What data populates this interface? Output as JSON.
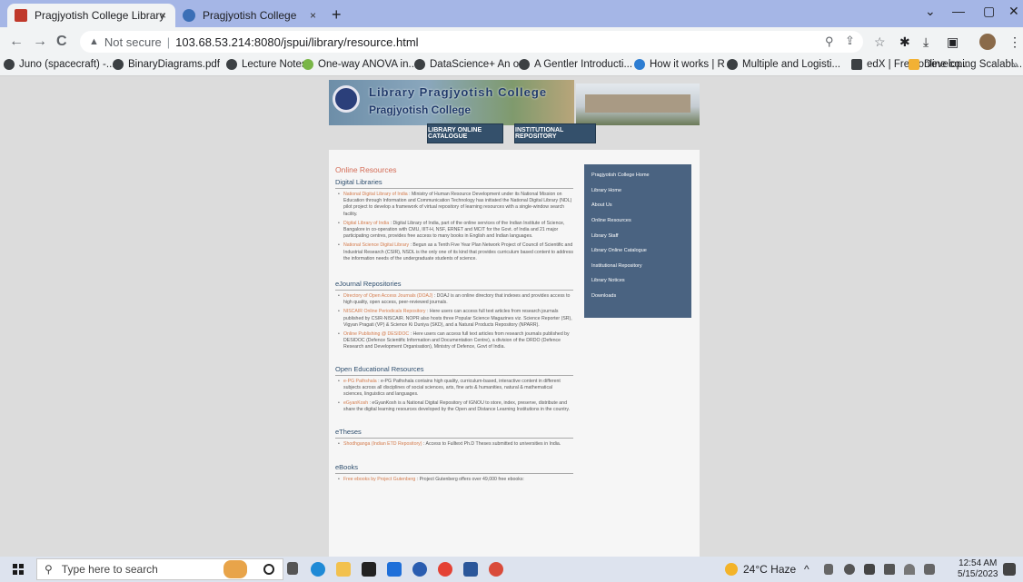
{
  "browser": {
    "tabs": [
      {
        "title": "Pragjyotish College Library",
        "close": "×"
      },
      {
        "title": "Pragjyotish College",
        "close": "×"
      }
    ],
    "new_tab": "+",
    "window_controls": {
      "minimize": "—",
      "maximize": "▢",
      "close": "✕",
      "dropdown": "⌄"
    },
    "nav": {
      "back": "←",
      "forward": "→",
      "reload": "C"
    },
    "address": {
      "security_icon": "▲",
      "security_label": "Not secure",
      "separator": "|",
      "url": "103.68.53.214:8080/jspui/library/resource.html"
    },
    "toolbar_icons": {
      "search": "⚲",
      "share": "⇪",
      "star": "☆",
      "extensions": "✱",
      "download": "⤓",
      "sidepanel": "▣",
      "menu": "⋮"
    },
    "bookmarks": [
      "Juno (spacecraft) -...",
      "BinaryDiagrams.pdf",
      "Lecture Notes",
      "One-way ANOVA in...",
      "DataScience+ An o...",
      "A Gentler Introducti...",
      "How it works | R",
      "Multiple and Logisti...",
      "edX | Free online co...",
      "Developing Scalabl..."
    ],
    "bookmarks_more": "»"
  },
  "site": {
    "banner_title": "Library Pragjyotish College",
    "banner_subtitle": "Pragjyotish College",
    "top_buttons": [
      "LIBRARY ONLINE CATALOGUE",
      "INSTITUTIONAL REPOSITORY"
    ],
    "heading": "Online Resources",
    "sections": [
      {
        "title": "Digital Libraries",
        "entries": [
          {
            "link": "National Digital Library of India",
            "text": " : Ministry of Human Resource Development under its National Mission on Education through Information and Communication Technology has initiated the National Digital Library (NDL) pilot project to develop a framework of virtual repository of learning resources with a single-window search facility."
          },
          {
            "link": "Digital Library of India",
            "text": " : Digital Library of India, part of the online services of the Indian Institute of Science, Bangalore in co-operation with CMU, IIIT-H, NSF, ERNET and MCIT for the Govt. of India and 21 major participating centres, provides free access to many books in English and Indian languages."
          },
          {
            "link": "National Science Digital Library",
            "text": " : Begun as a Tenth Five Year Plan Network Project of Council of Scientific and Industrial Research (CSIR), NSDL is the only one of its kind that provides curriculum based content to address the information needs of the undergraduate students of science."
          }
        ]
      },
      {
        "title": "eJournal Repositories",
        "entries": [
          {
            "link": "Directory of Open Access Journals (DOAJ)",
            "text": " : DOAJ is an online directory that indexes and provides access to high quality, open access, peer-reviewed journals."
          },
          {
            "link": "NISCAIR Online Periodicals Repository",
            "text": " : Here users can access full text articles from research journals published by CSIR-NISCAIR. NOPR also hosts three Popular Science Magazines viz. Science Reporter (SR), Vigyan Pragati (VP) & Science Ki Duniya (SKD), and a Natural Products Repository (NPARR)."
          },
          {
            "link": "Online Publishing @ DESIDOC",
            "text": " : Here users can access full text articles from research journals published by DESIDOC (Defence Scientific Information and Documentation Centre), a division of the DRDO (Defence Research and Development Organisation), Ministry of Defence, Govt of India."
          }
        ]
      },
      {
        "title": "Open Educational Resources",
        "entries": [
          {
            "link": "e-PG Pathshala",
            "text": " : e-PG Pathshala contains high quality, curriculum-based, interactive content in different subjects across all disciplines of social sciences, arts, fine arts & humanities, natural & mathematical sciences, linguistics and languages."
          },
          {
            "link": "eGyanKosh",
            "text": " : eGyanKosh is a National Digital Repository of IGNOU to store, index, preserve, distribute and share the digital learning resources developed by the Open and Distance Learning Institutions in the country."
          }
        ]
      },
      {
        "title": "eTheses",
        "entries": [
          {
            "link": "Shodhganga (Indian ETD Repository)",
            "text": " : Access to Fulltext Ph.D Theses submitted to universities in India."
          }
        ]
      },
      {
        "title": "eBooks",
        "entries": [
          {
            "link": "Free ebooks by Project Gutenberg",
            "text": " : Project Gutenberg offers over 49,000 free ebooks:"
          }
        ]
      }
    ],
    "sidebar": [
      "Pragjyotish College Home",
      "Library Home",
      "About Us",
      "Online Resources",
      "Library Staff",
      "Library Online Catalogue",
      "Institutional Repository",
      "Library Notices",
      "Downloads"
    ]
  },
  "taskbar": {
    "search_icon": "⚲",
    "search_placeholder": "Type here to search",
    "weather": "24°C Haze",
    "tray_chevron": "^",
    "time": "12:54 AM",
    "date": "5/15/2023"
  },
  "colors": {
    "tabstrip": "#a5b6e6",
    "sidebar": "#4a6381",
    "buttons": "#34506b",
    "link": "#d47b4c",
    "heading": "#d46b55"
  }
}
